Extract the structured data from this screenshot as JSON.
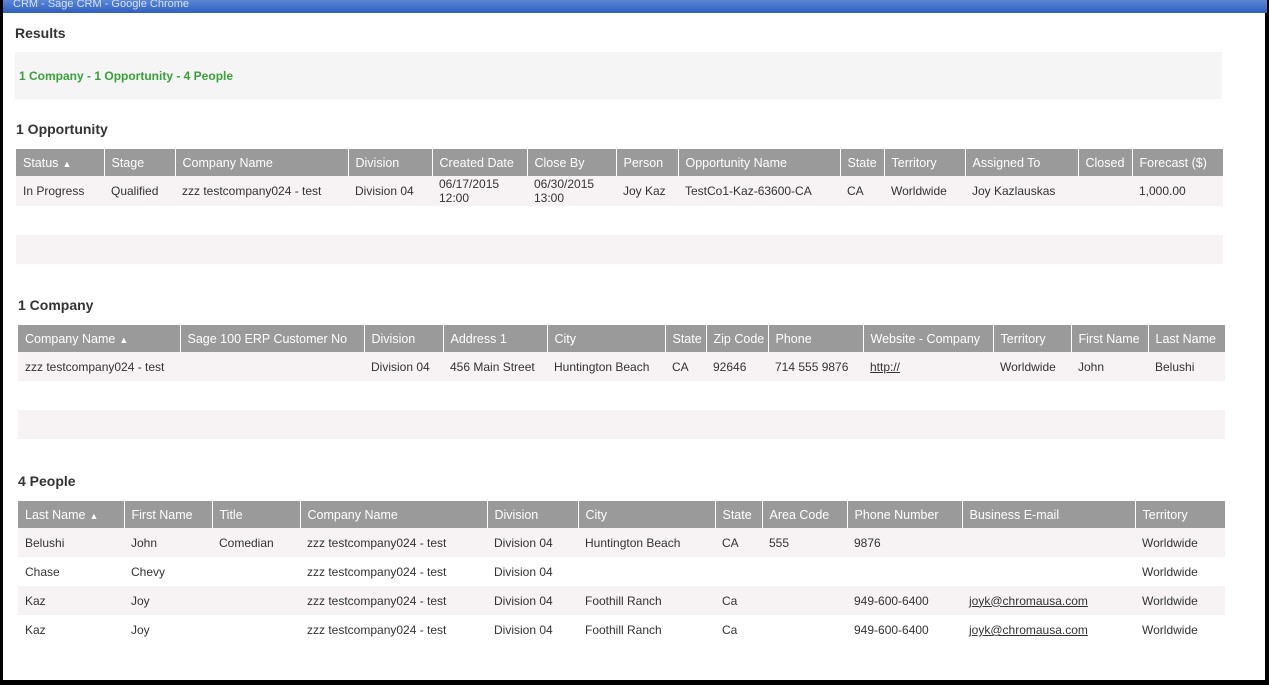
{
  "window": {
    "title": "CRM - Sage CRM - Google Chrome"
  },
  "results_heading": "Results",
  "summary": "1 Company - 1 Opportunity - 4 People",
  "opportunity": {
    "heading": "1 Opportunity",
    "columns": [
      "Status",
      "Stage",
      "Company Name",
      "Division",
      "Created Date",
      "Close By",
      "Person",
      "Opportunity Name",
      "State",
      "Territory",
      "Assigned To",
      "Closed",
      "Forecast ($)"
    ],
    "row": {
      "status": "In Progress",
      "stage": "Qualified",
      "company": "zzz testcompany024 - test",
      "division": "Division 04",
      "created_date": "06/17/2015",
      "created_time": "12:00",
      "close_date": "06/30/2015",
      "close_time": "13:00",
      "person": "Joy Kaz",
      "name": "TestCo1-Kaz-63600-CA",
      "state": "CA",
      "territory": "Worldwide",
      "assigned_to": "Joy Kazlauskas",
      "closed": "",
      "forecast": "1,000.00"
    }
  },
  "company": {
    "heading": "1 Company",
    "columns": [
      "Company Name",
      "Sage 100 ERP Customer No",
      "Division",
      "Address 1",
      "City",
      "State",
      "Zip Code",
      "Phone",
      "Website - Company",
      "Territory",
      "First Name",
      "Last Name"
    ],
    "row": {
      "name": "zzz testcompany024 - test",
      "erp_no": "",
      "division": "Division 04",
      "address": "456 Main Street",
      "city": "Huntington Beach",
      "state": "CA",
      "zip": "92646",
      "phone": "714 555 9876",
      "website": "http://",
      "territory": "Worldwide",
      "first_name": "John",
      "last_name": "Belushi"
    }
  },
  "people": {
    "heading": "4 People",
    "columns": [
      "Last Name",
      "First Name",
      "Title",
      "Company Name",
      "Division",
      "City",
      "State",
      "Area Code",
      "Phone Number",
      "Business E-mail",
      "Territory"
    ],
    "rows": [
      {
        "last": "Belushi",
        "first": "John",
        "title": "Comedian",
        "company": "zzz testcompany024 - test",
        "division": "Division 04",
        "city": "Huntington Beach",
        "state": "CA",
        "area": "555",
        "phone": "9876",
        "email": "",
        "territory": "Worldwide"
      },
      {
        "last": "Chase",
        "first": "Chevy",
        "title": "",
        "company": "zzz testcompany024 - test",
        "division": "Division 04",
        "city": "",
        "state": "",
        "area": "",
        "phone": "",
        "email": "",
        "territory": "Worldwide"
      },
      {
        "last": "Kaz",
        "first": "Joy",
        "title": "",
        "company": "zzz testcompany024 - test",
        "division": "Division 04",
        "city": "Foothill Ranch",
        "state": "Ca",
        "area": "",
        "phone": "949-600-6400",
        "email": "joyk@chromausa.com",
        "territory": "Worldwide"
      },
      {
        "last": "Kaz",
        "first": "Joy",
        "title": "",
        "company": "zzz testcompany024 - test",
        "division": "Division 04",
        "city": "Foothill Ranch",
        "state": "Ca",
        "area": "",
        "phone": "949-600-6400",
        "email": "joyk@chromausa.com",
        "territory": "Worldwide"
      }
    ]
  },
  "sort_arrow": "▲"
}
